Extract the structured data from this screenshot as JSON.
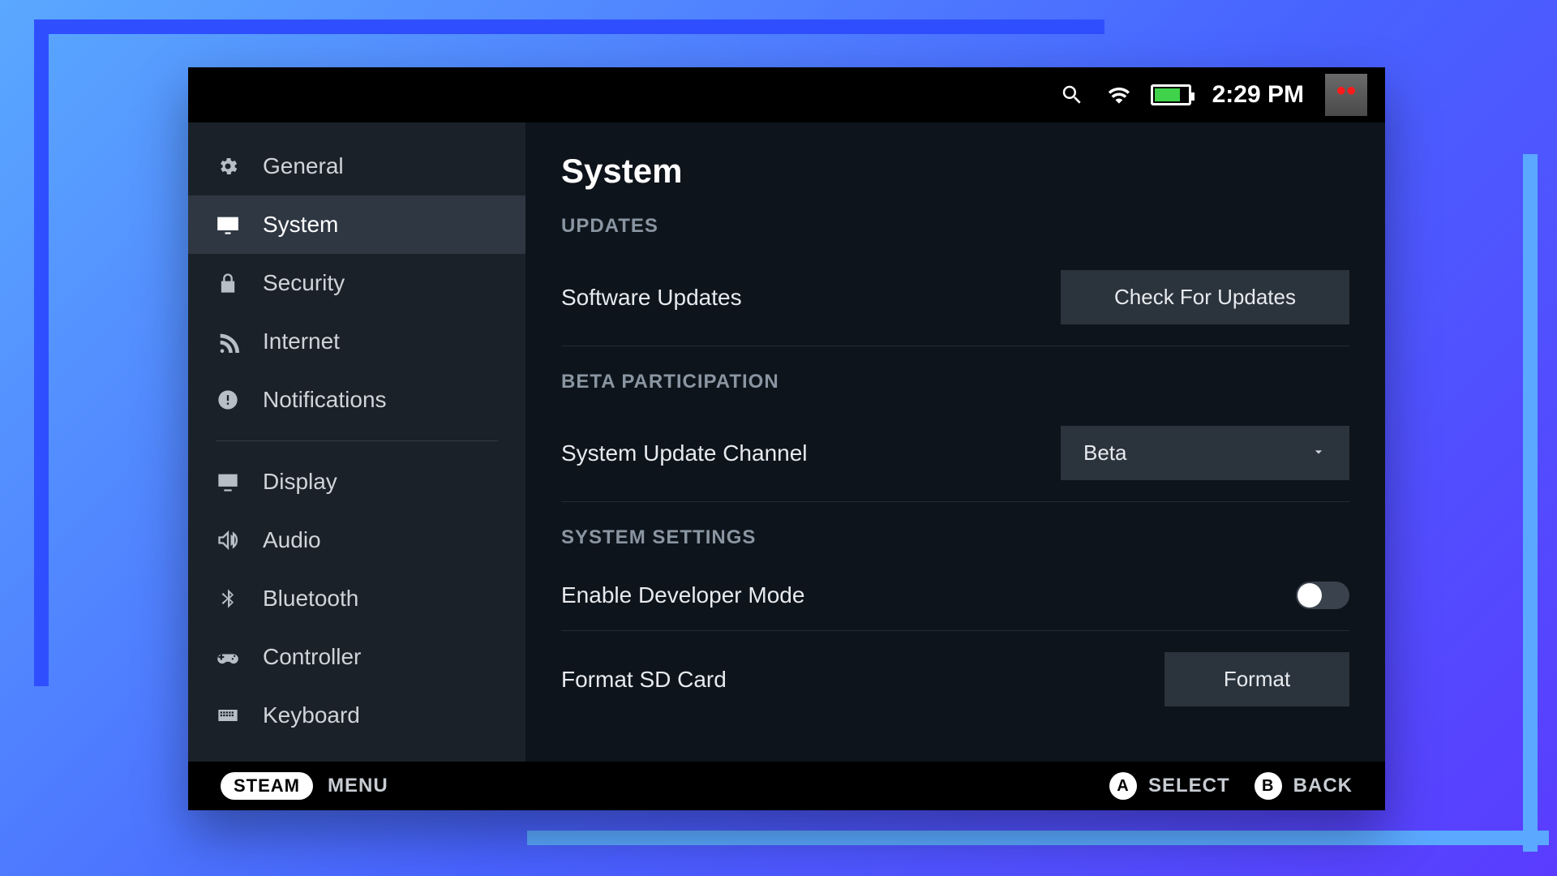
{
  "topbar": {
    "clock": "2:29 PM"
  },
  "sidebar": {
    "items": [
      {
        "label": "General"
      },
      {
        "label": "System"
      },
      {
        "label": "Security"
      },
      {
        "label": "Internet"
      },
      {
        "label": "Notifications"
      },
      {
        "label": "Display"
      },
      {
        "label": "Audio"
      },
      {
        "label": "Bluetooth"
      },
      {
        "label": "Controller"
      },
      {
        "label": "Keyboard"
      }
    ]
  },
  "main": {
    "title": "System",
    "sections": {
      "updates": {
        "header": "UPDATES",
        "software_label": "Software Updates",
        "check_button": "Check For Updates"
      },
      "beta": {
        "header": "BETA PARTICIPATION",
        "channel_label": "System Update Channel",
        "channel_value": "Beta"
      },
      "system": {
        "header": "SYSTEM SETTINGS",
        "dev_mode_label": "Enable Developer Mode",
        "format_label": "Format SD Card",
        "format_button": "Format"
      }
    }
  },
  "footer": {
    "steam": "STEAM",
    "menu": "MENU",
    "a_label": "SELECT",
    "b_label": "BACK",
    "a_glyph": "A",
    "b_glyph": "B"
  }
}
